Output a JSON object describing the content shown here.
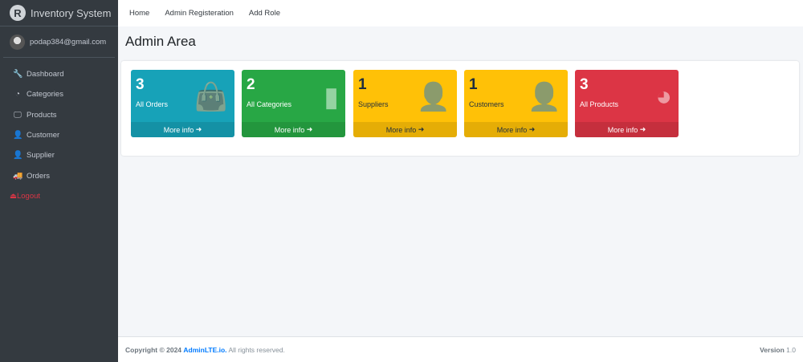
{
  "brand": {
    "title": "Inventory System",
    "logo_letter": "R"
  },
  "user": {
    "email": "podap384@gmail.com"
  },
  "sidebar": {
    "items": [
      {
        "label": "Dashboard",
        "icon": "wrench-icon",
        "glyph": "🔧"
      },
      {
        "label": "Categories",
        "icon": "gauge-icon",
        "glyph": "◔"
      },
      {
        "label": "Products",
        "icon": "desktop-icon",
        "glyph": "🖵"
      },
      {
        "label": "Customer",
        "icon": "user-icon",
        "glyph": "👤"
      },
      {
        "label": "Supplier",
        "icon": "user-icon",
        "glyph": "👤"
      },
      {
        "label": "Orders",
        "icon": "truck-icon",
        "glyph": "🚚"
      }
    ],
    "logout": "Logout"
  },
  "topnav": [
    "Home",
    "Admin Registeration",
    "Add Role"
  ],
  "page_title": "Admin Area",
  "cards": [
    {
      "value": "3",
      "label": "All Orders",
      "more": "More info",
      "color": "#17a2b8",
      "icon": "shopping-bag-icon",
      "glyph": "👜"
    },
    {
      "value": "2",
      "label": "All Categories",
      "more": "More info",
      "color": "#28a745",
      "icon": "bar-chart-icon",
      "glyph": "▮"
    },
    {
      "value": "1",
      "label": "Suppliers",
      "more": "More info",
      "color": "#ffc107",
      "icon": "user-plus-icon",
      "glyph": "👤"
    },
    {
      "value": "1",
      "label": "Customers",
      "more": "More info",
      "color": "#ffc107",
      "icon": "user-plus-icon",
      "glyph": "👤"
    },
    {
      "value": "3",
      "label": "All Products",
      "more": "More info",
      "color": "#dc3545",
      "icon": "pie-chart-icon",
      "glyph": "◕"
    }
  ],
  "footer": {
    "copyright": "Copyright © 2024",
    "link": "AdminLTE.io.",
    "rights": "All rights reserved.",
    "version_label": "Version",
    "version": "1.0"
  }
}
